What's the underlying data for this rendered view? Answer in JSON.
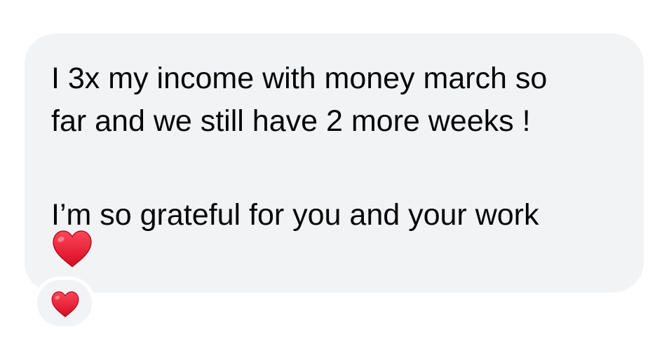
{
  "message": {
    "lines": [
      "I 3x my income with money march so",
      "far and we still have 2 more weeks !",
      "I’m so grateful for you and your work"
    ],
    "emoji": "red-heart"
  },
  "reaction": {
    "emoji": "red-heart"
  },
  "colors": {
    "bubble_bg": "#f2f3f5",
    "text": "#050505",
    "heart": "#e0132d"
  }
}
